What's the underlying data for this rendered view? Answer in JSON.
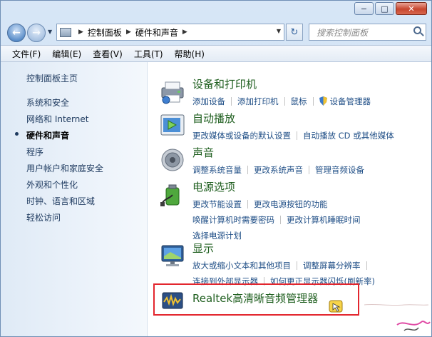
{
  "window": {
    "caption_buttons": [
      {
        "name": "minimize",
        "glyph": "−"
      },
      {
        "name": "maximize",
        "glyph": "□"
      },
      {
        "name": "close",
        "glyph": "✕"
      }
    ]
  },
  "navigation": {
    "breadcrumbs": [
      "控制面板",
      "硬件和声音"
    ],
    "search_placeholder": "搜索控制面板"
  },
  "menubar": {
    "items": [
      "文件(F)",
      "编辑(E)",
      "查看(V)",
      "工具(T)",
      "帮助(H)"
    ]
  },
  "sidebar": {
    "home": "控制面板主页",
    "items": [
      "系统和安全",
      "网络和 Internet",
      "硬件和声音",
      "程序",
      "用户帐户和家庭安全",
      "外观和个性化",
      "时钟、语言和区域",
      "轻松访问"
    ],
    "current": "硬件和声音"
  },
  "categories": [
    {
      "title": "设备和打印机",
      "icon": "printer-icon",
      "rows": [
        [
          "添加设备",
          "添加打印机",
          "鼠标",
          "设备管理器"
        ]
      ]
    },
    {
      "title": "自动播放",
      "icon": "autoplay-icon",
      "rows": [
        [
          "更改媒体或设备的默认设置",
          "自动播放 CD 或其他媒体"
        ]
      ]
    },
    {
      "title": "声音",
      "icon": "speaker-icon",
      "rows": [
        [
          "调整系统音量",
          "更改系统声音",
          "管理音频设备"
        ]
      ]
    },
    {
      "title": "电源选项",
      "icon": "power-icon",
      "rows": [
        [
          "更改节能设置",
          "更改电源按钮的功能"
        ],
        [
          "唤醒计算机时需要密码",
          "更改计算机睡眠时间"
        ],
        [
          "选择电源计划"
        ]
      ]
    },
    {
      "title": "显示",
      "icon": "display-icon",
      "rows": [
        [
          "放大或缩小文本和其他项目",
          "调整屏幕分辨率"
        ],
        [
          "连接到外部显示器",
          "如何更正显示器闪烁(刷新率)"
        ]
      ]
    }
  ],
  "realtek": {
    "title": "Realtek高清晰音频管理器",
    "icon": "realtek-audio-icon",
    "highlight_color": "#e3262e"
  }
}
